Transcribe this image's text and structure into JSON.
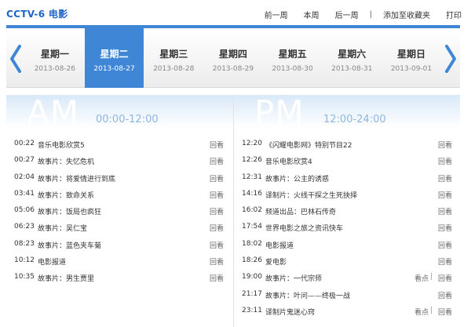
{
  "header": {
    "channel_title": "CCTV-6 电影",
    "links": [
      "前一周",
      "本周",
      "后一周",
      "添加至收藏夹",
      "打印"
    ],
    "separator": "|"
  },
  "weekbar": {
    "days": [
      {
        "name": "星期一",
        "date": "2013-08-26",
        "active": false
      },
      {
        "name": "星期二",
        "date": "2013-08-27",
        "active": true
      },
      {
        "name": "星期三",
        "date": "2013-08-28",
        "active": false
      },
      {
        "name": "星期四",
        "date": "2013-08-29",
        "active": false
      },
      {
        "name": "星期五",
        "date": "2013-08-30",
        "active": false
      },
      {
        "name": "星期六",
        "date": "2013-08-31",
        "active": false
      },
      {
        "name": "星期日",
        "date": "2013-09-01",
        "active": false
      }
    ],
    "prev_icon": "chevron-left-icon",
    "next_icon": "chevron-right-icon",
    "accent_color": "#3f87d6"
  },
  "am": {
    "label": "AM",
    "range": "00:00-12:00",
    "programs": [
      {
        "time": "00:22",
        "title": "音乐电影欣赏5",
        "watch": "回看"
      },
      {
        "time": "00:27",
        "title": "故事片：失忆危机",
        "watch": "回看"
      },
      {
        "time": "02:04",
        "title": "故事片：将爱情进行到底",
        "watch": "回看"
      },
      {
        "time": "03:41",
        "title": "故事片：致命关系",
        "watch": "回看"
      },
      {
        "time": "05:06",
        "title": "故事片：饭局也疯狂",
        "watch": "回看"
      },
      {
        "time": "06:23",
        "title": "故事片：吴仁宝",
        "watch": "回看"
      },
      {
        "time": "08:23",
        "title": "故事片：蓝色夹车菊",
        "watch": "回看"
      },
      {
        "time": "10:12",
        "title": "电影报道",
        "watch": "回看"
      },
      {
        "time": "10:35",
        "title": "故事片：男生贾里",
        "watch": "回看"
      }
    ]
  },
  "pm": {
    "label": "PM",
    "range": "12:00-24:00",
    "programs": [
      {
        "time": "12:20",
        "title": "《闪耀电影网》特别节目22",
        "watch": "回看"
      },
      {
        "time": "12:26",
        "title": "音乐电影欣赏4",
        "watch": "回看"
      },
      {
        "time": "12:31",
        "title": "故事片：公主的诱惑",
        "watch": "回看"
      },
      {
        "time": "14:16",
        "title": "译制片：火线干探之生死抉择",
        "watch": "回看"
      },
      {
        "time": "16:02",
        "title": "频道出品：巴林石传奇",
        "watch": "回看"
      },
      {
        "time": "17:54",
        "title": "世界电影之旅之资讯快车",
        "watch": "回看"
      },
      {
        "time": "18:02",
        "title": "电影报道",
        "watch": "回看"
      },
      {
        "time": "18:26",
        "title": "爱电影",
        "watch": "回看"
      },
      {
        "time": "19:00",
        "title": "故事片：一代宗师",
        "look": "看点",
        "watch": "回看"
      },
      {
        "time": "21:17",
        "title": "故事片：叶问——终极一战",
        "watch": "回看"
      },
      {
        "time": "23:11",
        "title": "译制片鬼迷心窍",
        "look": "看点",
        "watch": "回看"
      }
    ]
  }
}
